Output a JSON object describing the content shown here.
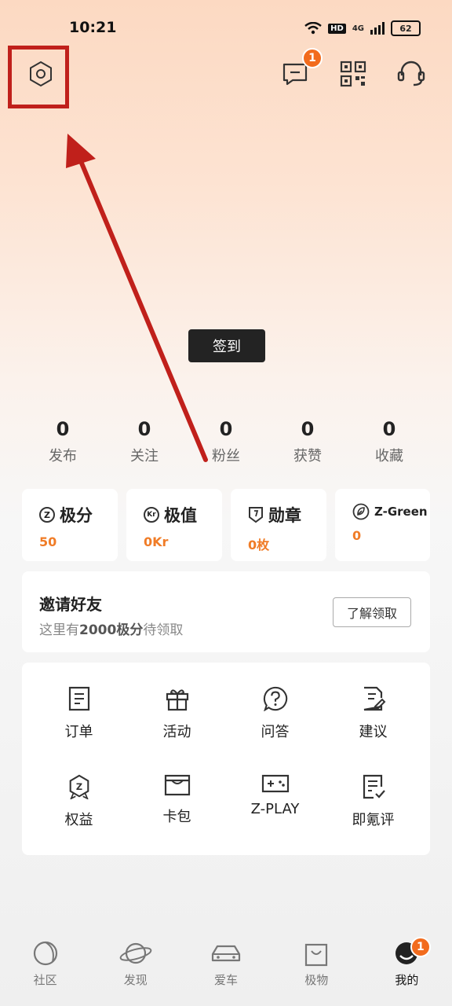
{
  "status_bar": {
    "time": "10:21",
    "network": "4G",
    "hd": "HD",
    "battery": "62"
  },
  "header": {
    "message_badge": "1",
    "icons": [
      "settings-icon",
      "message-icon",
      "qr-code-icon",
      "customer-service-icon"
    ]
  },
  "signin_label": "签到",
  "stats": [
    {
      "value": "0",
      "label": "发布"
    },
    {
      "value": "0",
      "label": "关注"
    },
    {
      "value": "0",
      "label": "粉丝"
    },
    {
      "value": "0",
      "label": "获赞"
    },
    {
      "value": "0",
      "label": "收藏"
    }
  ],
  "assets": [
    {
      "title": "极分",
      "value": "50",
      "icon_text": "Z"
    },
    {
      "title": "极值",
      "value": "0Kr",
      "icon_text": "Kr"
    },
    {
      "title": "勋章",
      "value": "0枚"
    },
    {
      "title": "Z-Green",
      "value": "0"
    }
  ],
  "invite": {
    "title": "邀请好友",
    "sub_prefix": "这里有",
    "sub_bold": "2000极分",
    "sub_suffix": "待领取",
    "button": "了解领取"
  },
  "services": [
    {
      "label": "订单",
      "icon": "order-icon"
    },
    {
      "label": "活动",
      "icon": "gift-icon"
    },
    {
      "label": "问答",
      "icon": "question-icon"
    },
    {
      "label": "建议",
      "icon": "suggestion-icon"
    },
    {
      "label": "权益",
      "icon": "benefit-icon"
    },
    {
      "label": "卡包",
      "icon": "card-wallet-icon"
    },
    {
      "label": "Z-PLAY",
      "icon": "gamepad-icon"
    },
    {
      "label": "即氪评",
      "icon": "review-icon"
    }
  ],
  "bottom_nav": [
    {
      "label": "社区",
      "icon": "community-icon"
    },
    {
      "label": "发现",
      "icon": "planet-icon"
    },
    {
      "label": "爱车",
      "icon": "car-icon"
    },
    {
      "label": "极物",
      "icon": "shopping-bag-icon"
    },
    {
      "label": "我的",
      "icon": "avatar-icon",
      "badge": "1",
      "active": true
    }
  ],
  "colors": {
    "accent": "#f07c27",
    "badge": "#f26b1d",
    "annotation": "#c0201b"
  }
}
